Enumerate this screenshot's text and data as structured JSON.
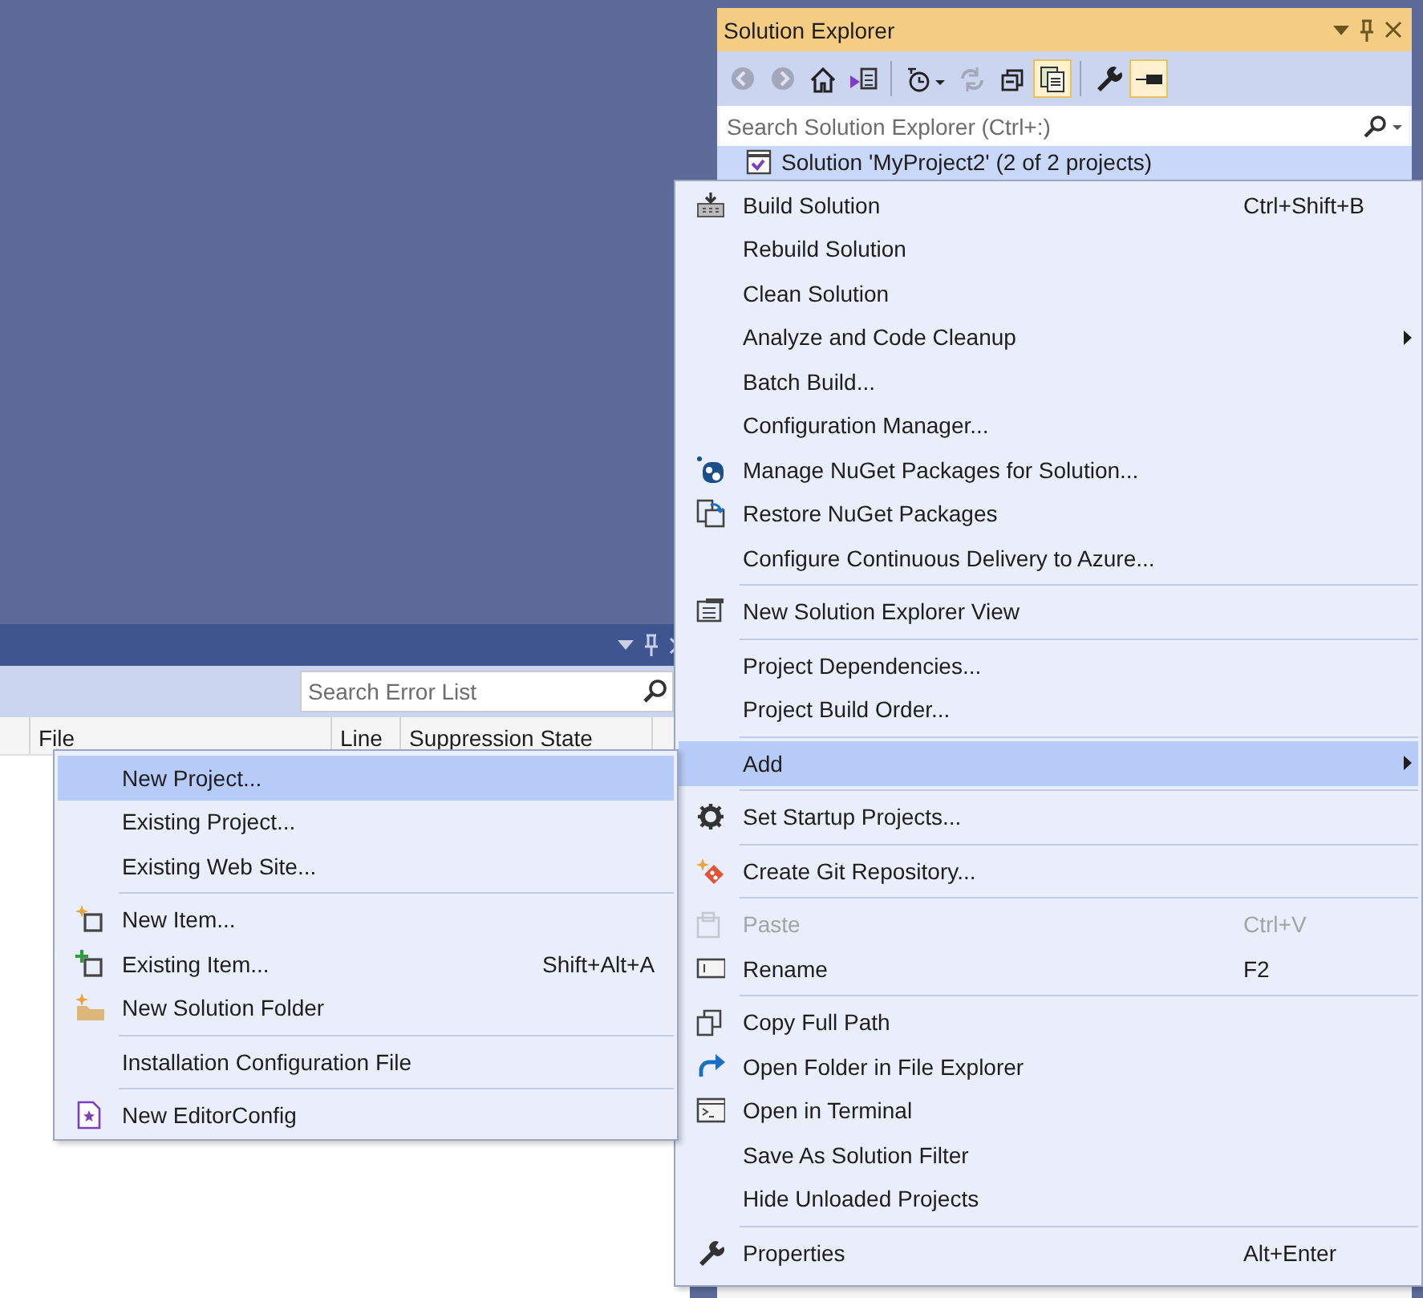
{
  "solution_explorer": {
    "title": "Solution Explorer",
    "toolbar": [
      {
        "disabled": true,
        "pressed": false
      },
      {
        "disabled": true,
        "pressed": false
      },
      {
        "disabled": false,
        "pressed": false
      },
      {
        "disabled": false,
        "pressed": false
      },
      {
        "disabled": false,
        "pressed": false
      },
      {
        "disabled": true,
        "pressed": false
      },
      {
        "disabled": false,
        "pressed": false
      },
      {
        "disabled": false,
        "pressed": true
      },
      {
        "disabled": false,
        "pressed": false
      },
      {
        "disabled": false,
        "pressed": true
      }
    ],
    "search": {
      "placeholder": "Search Solution Explorer (Ctrl+:)"
    },
    "tree": [
      {
        "label": "Solution 'MyProject2' (2 of 2 projects)",
        "selected": true
      }
    ]
  },
  "error_list": {
    "search": {
      "placeholder": "Search Error List"
    },
    "columns": [
      "File",
      "Line",
      "Suppression State"
    ]
  },
  "context_menu": {
    "items": [
      {
        "kind": "item",
        "label": "Build Solution",
        "shortcut": "Ctrl+Shift+B",
        "has_submenu": false,
        "disabled": false,
        "selected": false
      },
      {
        "kind": "item",
        "label": "Rebuild Solution",
        "has_submenu": false,
        "disabled": false,
        "selected": false
      },
      {
        "kind": "item",
        "label": "Clean Solution",
        "has_submenu": false,
        "disabled": false,
        "selected": false
      },
      {
        "kind": "item",
        "label": "Analyze and Code Cleanup",
        "has_submenu": true,
        "disabled": false,
        "selected": false
      },
      {
        "kind": "item",
        "label": "Batch Build...",
        "has_submenu": false,
        "disabled": false,
        "selected": false
      },
      {
        "kind": "item",
        "label": "Configuration Manager...",
        "has_submenu": false,
        "disabled": false,
        "selected": false
      },
      {
        "kind": "item",
        "label": "Manage NuGet Packages for Solution...",
        "has_submenu": false,
        "disabled": false,
        "selected": false
      },
      {
        "kind": "item",
        "label": "Restore NuGet Packages",
        "has_submenu": false,
        "disabled": false,
        "selected": false
      },
      {
        "kind": "item",
        "label": "Configure Continuous Delivery to Azure...",
        "has_submenu": false,
        "disabled": false,
        "selected": false
      },
      {
        "kind": "separator"
      },
      {
        "kind": "item",
        "label": "New Solution Explorer View",
        "has_submenu": false,
        "disabled": false,
        "selected": false
      },
      {
        "kind": "separator"
      },
      {
        "kind": "item",
        "label": "Project Dependencies...",
        "has_submenu": false,
        "disabled": false,
        "selected": false
      },
      {
        "kind": "item",
        "label": "Project Build Order...",
        "has_submenu": false,
        "disabled": false,
        "selected": false
      },
      {
        "kind": "separator"
      },
      {
        "kind": "item",
        "label": "Add",
        "has_submenu": true,
        "disabled": false,
        "selected": true
      },
      {
        "kind": "separator"
      },
      {
        "kind": "item",
        "label": "Set Startup Projects...",
        "has_submenu": false,
        "disabled": false,
        "selected": false
      },
      {
        "kind": "separator"
      },
      {
        "kind": "item",
        "label": "Create Git Repository...",
        "has_submenu": false,
        "disabled": false,
        "selected": false
      },
      {
        "kind": "separator"
      },
      {
        "kind": "item",
        "label": "Paste",
        "shortcut": "Ctrl+V",
        "has_submenu": false,
        "disabled": true,
        "selected": false
      },
      {
        "kind": "item",
        "label": "Rename",
        "shortcut": "F2",
        "has_submenu": false,
        "disabled": false,
        "selected": false
      },
      {
        "kind": "separator"
      },
      {
        "kind": "item",
        "label": "Copy Full Path",
        "has_submenu": false,
        "disabled": false,
        "selected": false
      },
      {
        "kind": "item",
        "label": "Open Folder in File Explorer",
        "has_submenu": false,
        "disabled": false,
        "selected": false
      },
      {
        "kind": "item",
        "label": "Open in Terminal",
        "has_submenu": false,
        "disabled": false,
        "selected": false
      },
      {
        "kind": "item",
        "label": "Save As Solution Filter",
        "has_submenu": false,
        "disabled": false,
        "selected": false
      },
      {
        "kind": "item",
        "label": "Hide Unloaded Projects",
        "has_submenu": false,
        "disabled": false,
        "selected": false
      },
      {
        "kind": "separator"
      },
      {
        "kind": "item",
        "label": "Properties",
        "shortcut": "Alt+Enter",
        "has_submenu": false,
        "disabled": false,
        "selected": false
      }
    ]
  },
  "submenu": {
    "items": [
      {
        "kind": "item",
        "label": "New Project...",
        "disabled": false,
        "selected": true
      },
      {
        "kind": "item",
        "label": "Existing Project...",
        "disabled": false,
        "selected": false
      },
      {
        "kind": "item",
        "label": "Existing Web Site...",
        "disabled": false,
        "selected": false
      },
      {
        "kind": "separator"
      },
      {
        "kind": "item",
        "label": "New Item...",
        "disabled": false,
        "selected": false
      },
      {
        "kind": "item",
        "label": "Existing Item...",
        "shortcut": "Shift+Alt+A",
        "disabled": false,
        "selected": false
      },
      {
        "kind": "item",
        "label": "New Solution Folder",
        "disabled": false,
        "selected": false
      },
      {
        "kind": "separator"
      },
      {
        "kind": "item",
        "label": "Installation Configuration File",
        "disabled": false,
        "selected": false
      },
      {
        "kind": "separator"
      },
      {
        "kind": "item",
        "label": "New EditorConfig",
        "disabled": false,
        "selected": false
      }
    ]
  }
}
